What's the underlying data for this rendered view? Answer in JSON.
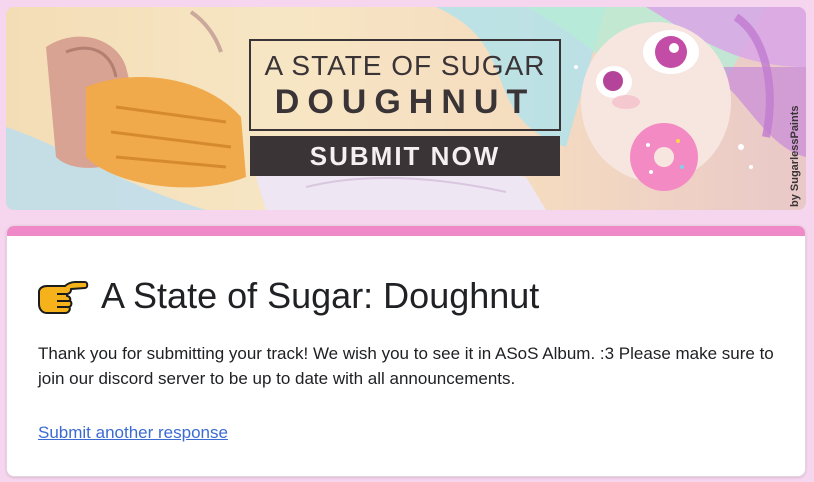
{
  "banner": {
    "heading_line1": "A STATE OF SUGAR",
    "heading_line2": "DOUGHNUT",
    "cta_label": "SUBMIT NOW",
    "credit": "by SugarlessPaints"
  },
  "form": {
    "title": "A State of Sugar: Doughnut",
    "message": "Thank you for submitting your track! We wish you to see it in ASoS Album. :3 Please make sure to join our discord server to be up to date with all announcements.",
    "link_label": "Submit another response"
  },
  "colors": {
    "page_background": "#f6d5ee",
    "card_accent": "#f089c7",
    "link": "#3b6bd1",
    "cta_background": "#3a3437"
  },
  "icons": {
    "title_icon": "backhand-index-pointing-right"
  }
}
